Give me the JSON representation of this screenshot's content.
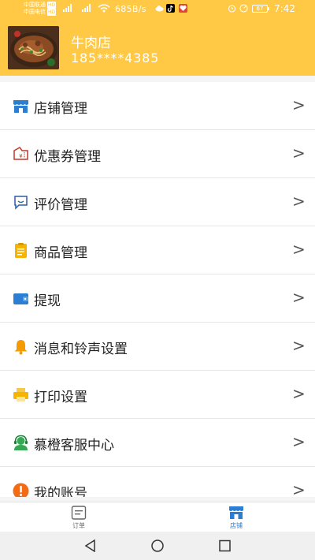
{
  "status_bar": {
    "carrier1": "中国联通",
    "carrier2": "中国电信",
    "hd": "HD",
    "speed": "685B/s",
    "battery": "67",
    "time": "7:42"
  },
  "header": {
    "shop_name": "牛肉店",
    "phone": "185****4385"
  },
  "menu": {
    "items": [
      {
        "label": "店铺管理",
        "icon": "storefront-icon"
      },
      {
        "label": "优惠券管理",
        "icon": "coupon-icon"
      },
      {
        "label": "评价管理",
        "icon": "comment-icon"
      },
      {
        "label": "商品管理",
        "icon": "clipboard-icon"
      },
      {
        "label": "提现",
        "icon": "wallet-icon"
      },
      {
        "label": "消息和铃声设置",
        "icon": "bell-icon"
      },
      {
        "label": "打印设置",
        "icon": "printer-icon"
      },
      {
        "label": "慕橙客服中心",
        "icon": "headset-icon"
      },
      {
        "label": "我的账号",
        "icon": "exclamation-icon"
      }
    ],
    "chevron": ">"
  },
  "tabbar": {
    "orders_label": "订单",
    "shop_label": "店铺"
  },
  "colors": {
    "header": "#ffc845",
    "active_tab": "#2a7fd4",
    "inactive_tab": "#666666"
  }
}
